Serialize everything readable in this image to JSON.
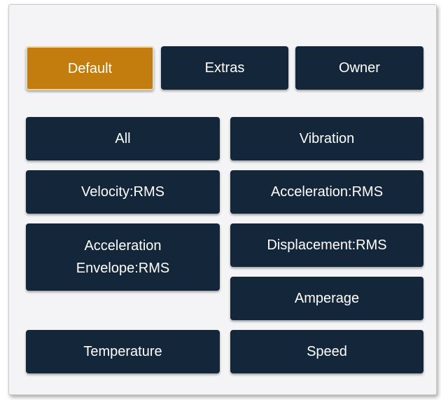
{
  "tabs": {
    "default_label": "Default",
    "extras_label": "Extras",
    "owner_label": "Owner",
    "active": "Default",
    "active_color": "#c27d0e",
    "button_color": "#14263a"
  },
  "filters": {
    "all": "All",
    "vibration": "Vibration",
    "velocity_rms": "Velocity:RMS",
    "acceleration_rms": "Acceleration:RMS",
    "acceleration_envelope_rms": "Acceleration\nEnvelope:RMS",
    "displacement_rms": "Displacement:RMS",
    "amperage": "Amperage",
    "temperature": "Temperature",
    "speed": "Speed"
  }
}
